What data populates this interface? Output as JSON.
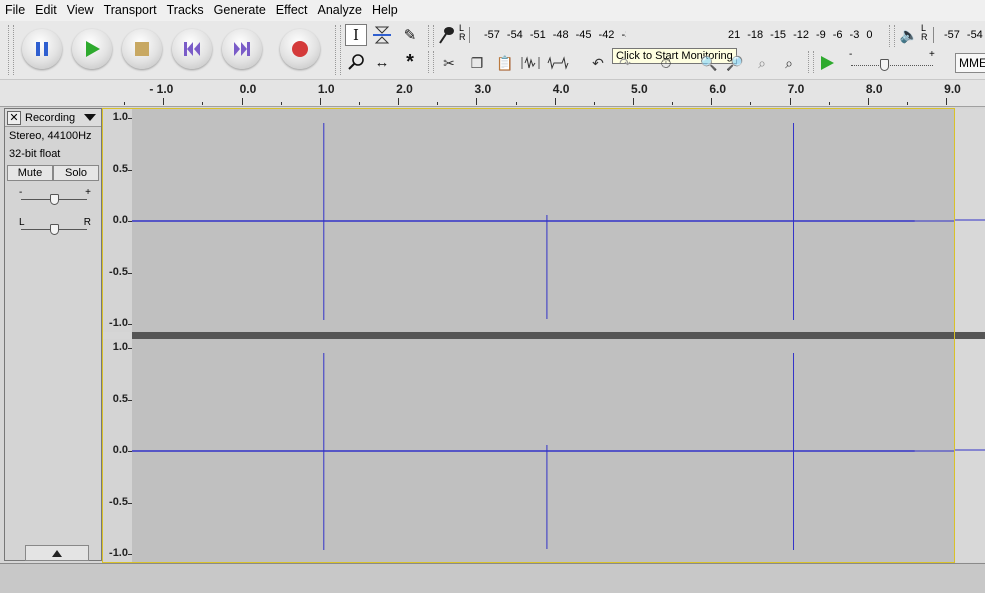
{
  "menu": [
    "File",
    "Edit",
    "View",
    "Transport",
    "Tracks",
    "Generate",
    "Effect",
    "Analyze",
    "Help"
  ],
  "transport": {
    "pause": "pause-icon",
    "play": "play-icon",
    "stop": "stop-icon",
    "skip_start": "skip-to-start-icon",
    "skip_end": "skip-to-end-icon",
    "record": "record-icon"
  },
  "record_meter": {
    "lr": "L\nR",
    "scale": [
      "-57",
      "-54",
      "-51",
      "-48",
      "-45",
      "-42",
      "-3"
    ],
    "scale_right": [
      "21",
      "-18",
      "-15",
      "-12",
      "-9",
      "-6",
      "-3",
      "0"
    ]
  },
  "playback_meter": {
    "lr": "L\nR",
    "scale": [
      "-57",
      "-54"
    ]
  },
  "tooltip": "Click to Start Monitoring",
  "device": "MME",
  "playback_slider": {
    "minus": "-",
    "plus": "+",
    "level": 0.4
  },
  "ruler": [
    "- 1.0",
    "0.0",
    "1.0",
    "2.0",
    "3.0",
    "4.0",
    "5.0",
    "6.0",
    "7.0",
    "8.0",
    "9.0"
  ],
  "track": {
    "close": "✕",
    "name": "Recording",
    "format": "Stereo, 44100Hz",
    "bitdepth": "32-bit float",
    "mute": "Mute",
    "solo": "Solo",
    "gain": {
      "minus": "-",
      "plus": "+"
    },
    "pan": {
      "left": "L",
      "right": "R"
    },
    "collapse": "collapse-icon"
  },
  "amplitude_labels": [
    "1.0",
    "0.5",
    "0.0",
    "-0.5",
    "-1.0"
  ],
  "clips": {
    "spike_times": [
      1.05,
      3.9,
      7.05
    ],
    "clip_end_time": 8.6,
    "view_start": -1.4,
    "view_end": 9.1
  },
  "colors": {
    "waveform": "#3232c8",
    "wave_bg": "#c0c0c0",
    "selection_outline": "#d8c12a"
  }
}
